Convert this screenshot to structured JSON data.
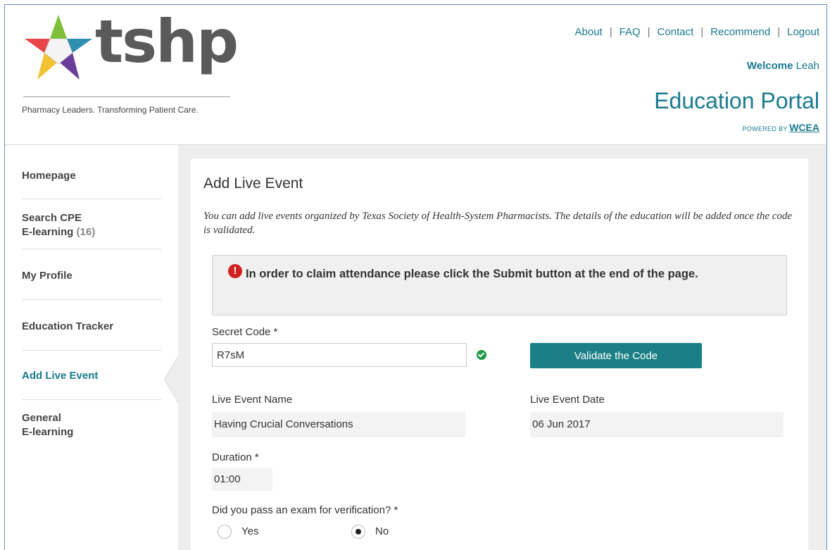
{
  "header": {
    "logo_text": "tshp",
    "tagline": "Pharmacy Leaders. Transforming Patient Care.",
    "nav": [
      {
        "label": "About"
      },
      {
        "label": "FAQ"
      },
      {
        "label": "Contact"
      },
      {
        "label": "Recommend"
      },
      {
        "label": "Logout"
      }
    ],
    "welcome_word": "Welcome",
    "user_name": "Leah",
    "portal_title": "Education Portal",
    "powered_by": "POWERED BY",
    "powered_brand": "WCEA"
  },
  "sidebar": {
    "items": [
      {
        "label": "Homepage"
      },
      {
        "label": "Search CPE",
        "label2": "E-learning",
        "count": "(16)"
      },
      {
        "label": "My Profile"
      },
      {
        "label": "Education Tracker"
      },
      {
        "label": "Add Live Event"
      },
      {
        "label": "General",
        "label2": "E-learning"
      }
    ],
    "active_index": 4
  },
  "main": {
    "title": "Add Live Event",
    "intro": "You can add live events organized by Texas Society of Health-System Pharmacists. The details of the education will be added once the code is validated.",
    "alert": "In order to claim attendance please click the Submit button at the end of the page.",
    "secret_code_label": "Secret Code *",
    "secret_code_value": "R7sM",
    "validate_label": "Validate the Code",
    "event_name_label": "Live Event Name",
    "event_name_value": "Having Crucial Conversations",
    "event_date_label": "Live Event Date",
    "event_date_value": "06 Jun 2017",
    "duration_label": "Duration *",
    "duration_value": "01:00",
    "exam_question": "Did you pass an exam for verification? *",
    "exam_options": [
      {
        "label": "Yes",
        "selected": false
      },
      {
        "label": "No",
        "selected": true
      }
    ]
  },
  "colors": {
    "accent": "#1a7a8f",
    "button": "#1a7f86",
    "alert_icon": "#d02020",
    "valid_check": "#1f9a4a"
  },
  "icons": [
    "logo-star-icon",
    "alert-exclamation-icon",
    "check-circle-icon"
  ]
}
